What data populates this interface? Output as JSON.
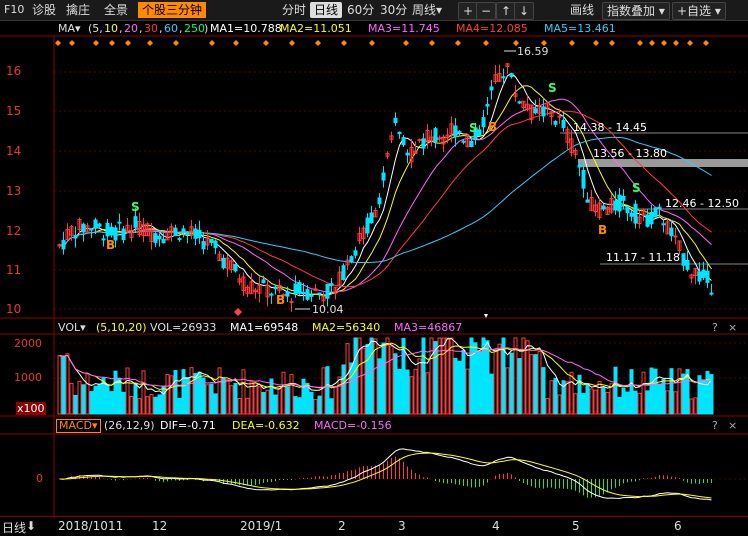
{
  "toolbar": {
    "f10": "F10",
    "diagnose": "诊股",
    "pick": "擒庄",
    "full": "全景",
    "current": "个股三分钟",
    "periods": [
      "分时",
      "日线",
      "60分",
      "30分",
      "周线▾"
    ],
    "draw": "画线",
    "overlay": "指数叠加 ▾",
    "custom": "+自选 ▾",
    "plus": "+",
    "minus": "−",
    "up": "↑",
    "down": "↓"
  },
  "ma_legend": {
    "name": "MA▾",
    "params_prefix": "(5,",
    "params": [
      "10",
      "20",
      "30",
      "60",
      "250"
    ],
    "params_suffix": ")",
    "ma1": "MA1=10.788",
    "ma2": "MA2=11.051",
    "ma3": "MA3=11.745",
    "ma4": "MA4=12.085",
    "ma5": "MA5=13.461"
  },
  "vol_legend": {
    "name": "VOL▾",
    "params": "(5,10,20)",
    "vol": "VOL=26933",
    "ma1": "MA1=69548",
    "ma2": "MA2=56340",
    "ma3": "MA3=46867"
  },
  "macd_legend": {
    "name": "MACD▾",
    "params": "(26,12,9)",
    "dif": "DIF=-0.71",
    "dea": "DEA=-0.632",
    "macd": "MACD=-0.156"
  },
  "price_axis": [
    "16",
    "15",
    "14",
    "13",
    "12",
    "11",
    "10"
  ],
  "vol_axis": [
    "2000",
    "1000",
    "x100"
  ],
  "macd_axis": [
    "0"
  ],
  "x_axis": [
    "2018/10",
    "11",
    "12",
    "2019/1",
    "2",
    "3",
    "4",
    "5",
    "6"
  ],
  "period_label": "日线",
  "annotations": {
    "high": "16.59",
    "low": "10.04",
    "zones": [
      "14.38 - 14.45",
      "13.56 - 13.80",
      "12.46 - 12.50",
      "11.17 - 11.18"
    ],
    "buy": "B",
    "sell": "S",
    "question": "?",
    "close": "×"
  },
  "colors": {
    "up": "#ff3b3b",
    "down": "#00e5ff",
    "ma1": "#ffffff",
    "ma2": "#ffff00",
    "ma3": "#ff66ff",
    "ma4": "#ff3b3b",
    "ma5": "#33ccff",
    "accent": "#ff8a00"
  }
}
